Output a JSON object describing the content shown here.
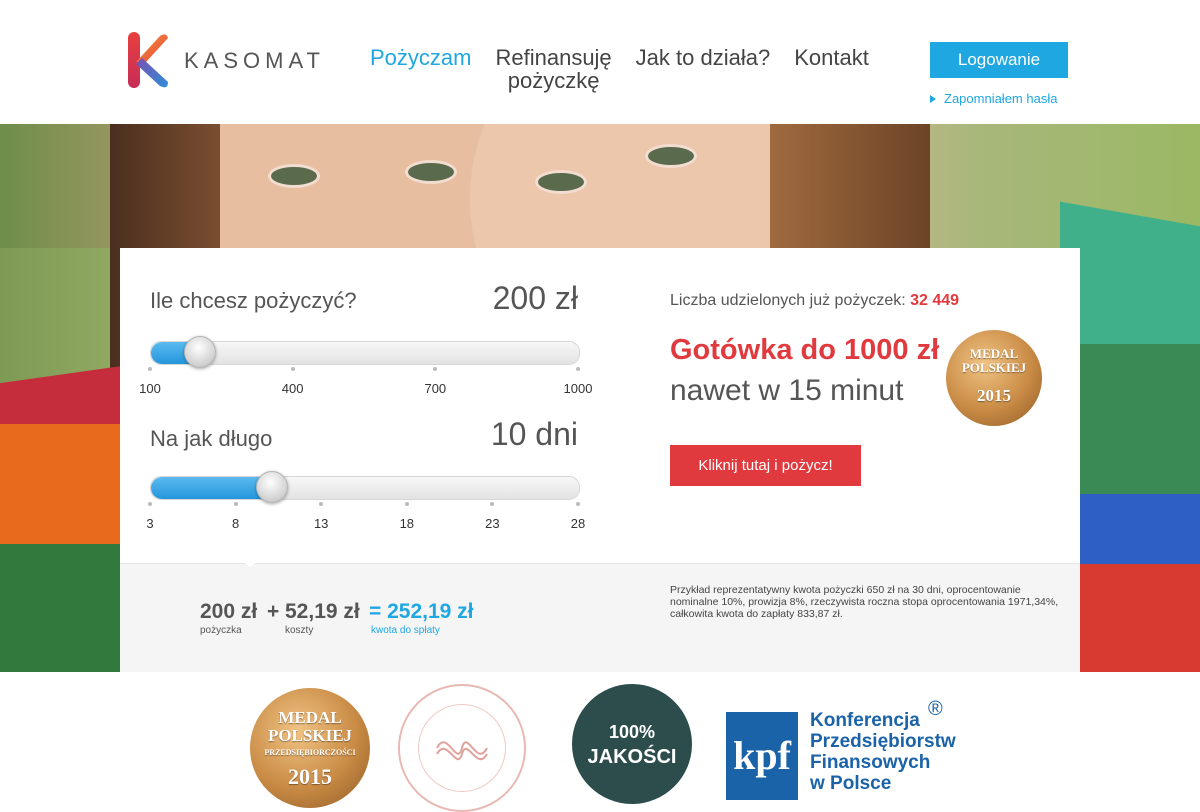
{
  "header": {
    "brand": "KASOMAT",
    "nav": [
      {
        "label_line1": "Pożyczam",
        "label_line2": ""
      },
      {
        "label_line1": "Refinansuję",
        "label_line2": "pożyczkę"
      },
      {
        "label_line1": "Jak to działa?",
        "label_line2": ""
      },
      {
        "label_line1": "Kontakt",
        "label_line2": ""
      }
    ],
    "login_label": "Logowanie",
    "forgot_label": "Zapomniałem hasła"
  },
  "calculator": {
    "amount": {
      "question": "Ile chcesz pożyczyć?",
      "value": "200 zł",
      "ticks": [
        "100",
        "400",
        "700",
        "1000"
      ],
      "min": 100,
      "max": 1000,
      "current": 200
    },
    "duration": {
      "question": "Na jak długo",
      "value": "10 dni",
      "ticks": [
        "3",
        "8",
        "13",
        "18",
        "23",
        "28"
      ],
      "min": 3,
      "max": 28,
      "current": 10
    },
    "summary": {
      "loan": "200 zł",
      "plus": "+",
      "cost": "52,19 zł",
      "equals": "= 252,19 zł",
      "loan_caption": "pożyczka",
      "cost_caption": "koszty",
      "total_caption": "kwota do spłaty"
    },
    "legal": "Przykład reprezentatywny kwota pożyczki 650 zł na 30 dni, oprocentowanie nominalne 10%, prowizja 8%, rzeczywista roczna stopa oprocentowania 1971,34%, całkowita kwota do zapłaty 833,87 zł."
  },
  "promo": {
    "count_label": "Liczba udzielonych już pożyczek:",
    "count_value": "32 449",
    "headline": "Gotówka do 1000 zł",
    "subline": "nawet w 15 minut",
    "cta_label": "Kliknij tutaj i pożycz!"
  },
  "badges": {
    "medal_line1": "MEDAL",
    "medal_line2": "POLSKIEJ",
    "medal_line3": "PRZEDSIĘBIORCZOŚCI",
    "medal_year": "2015",
    "seal_line1": "100%",
    "seal_line2": "JAKOŚCI",
    "kpf_abbr": "kpf",
    "kpf_line1": "Konferencja",
    "kpf_line2": "Przedsiębiorstw",
    "kpf_line3": "Finansowych",
    "kpf_line4": "w Polsce",
    "kpf_reg": "®"
  },
  "colors": {
    "accent_blue": "#1ea7e1",
    "accent_red": "#e03a3e",
    "text_gray": "#555555"
  }
}
